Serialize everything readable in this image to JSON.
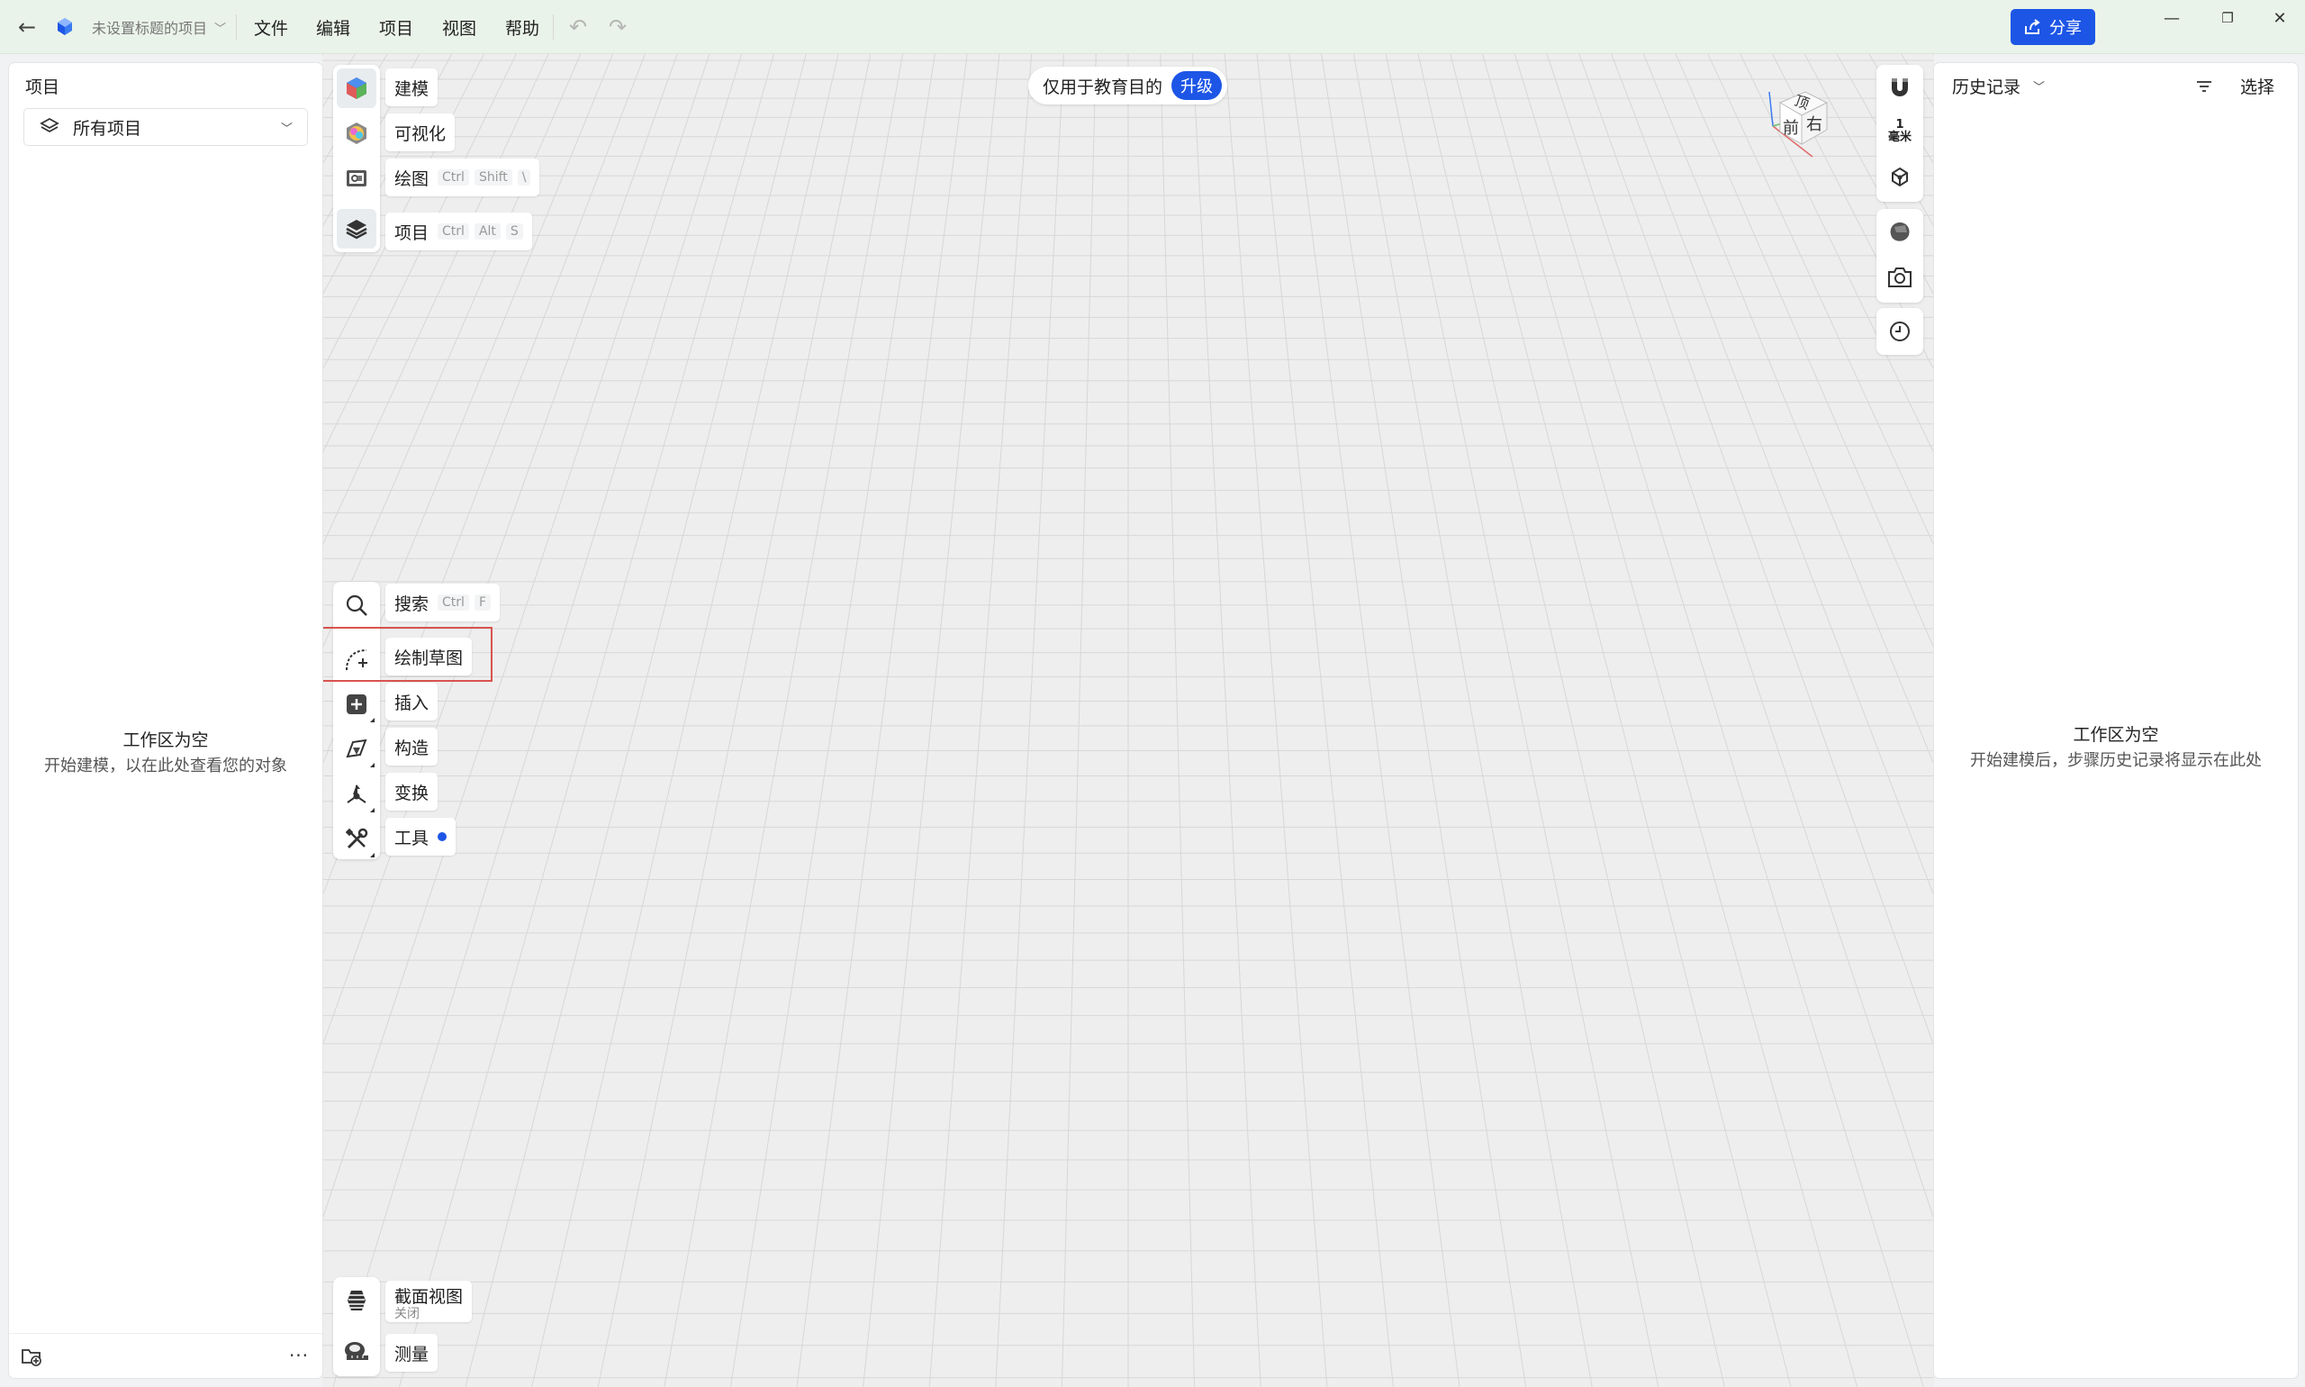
{
  "titlebar": {
    "project_name": "未设置标题的项目",
    "menu": [
      "文件",
      "编辑",
      "项目",
      "视图",
      "帮助"
    ],
    "share_label": "分享",
    "icons": {
      "back": "back-arrow-icon",
      "logo": "app-logo-icon",
      "undo": "undo-icon",
      "redo": "redo-icon",
      "share": "share-icon"
    },
    "window_controls": {
      "minimize": "—",
      "restore": "❐",
      "close": "✕"
    }
  },
  "left_panel": {
    "title": "项目",
    "filter_label": "所有项目",
    "empty_title": "工作区为空",
    "empty_subtitle": "开始建模，以在此处查看您的对象",
    "more_label": "···"
  },
  "right_panel": {
    "title": "历史记录",
    "select_label": "选择",
    "empty_title": "工作区为空",
    "empty_subtitle": "开始建模后，步骤历史记录将显示在此处"
  },
  "viewport": {
    "edu_text": "仅用于教育目的",
    "upgrade_label": "升级",
    "scale_value": "1",
    "scale_unit": "毫米",
    "viewcube_faces": {
      "top": "顶",
      "front": "前",
      "right": "右"
    }
  },
  "top_tools": [
    {
      "label": "建模",
      "keys": []
    },
    {
      "label": "可视化",
      "keys": []
    },
    {
      "label": "绘图",
      "keys": [
        "Ctrl",
        "Shift",
        "\\"
      ]
    },
    {
      "label": "项目",
      "keys": [
        "Ctrl",
        "Alt",
        "S"
      ]
    }
  ],
  "mid_tools": [
    {
      "label": "搜索",
      "keys": [
        "Ctrl",
        "F"
      ]
    },
    {
      "label": "绘制草图",
      "keys": []
    },
    {
      "label": "插入",
      "keys": []
    },
    {
      "label": "构造",
      "keys": []
    },
    {
      "label": "变换",
      "keys": []
    },
    {
      "label": "工具",
      "keys": []
    }
  ],
  "bottom_tools": [
    {
      "label": "截面视图",
      "sublabel": "关闭"
    },
    {
      "label": "测量"
    }
  ],
  "colors": {
    "accent": "#1d56e6",
    "titlebar_bg": "#eaf3e9",
    "highlight": "#d9534f"
  }
}
